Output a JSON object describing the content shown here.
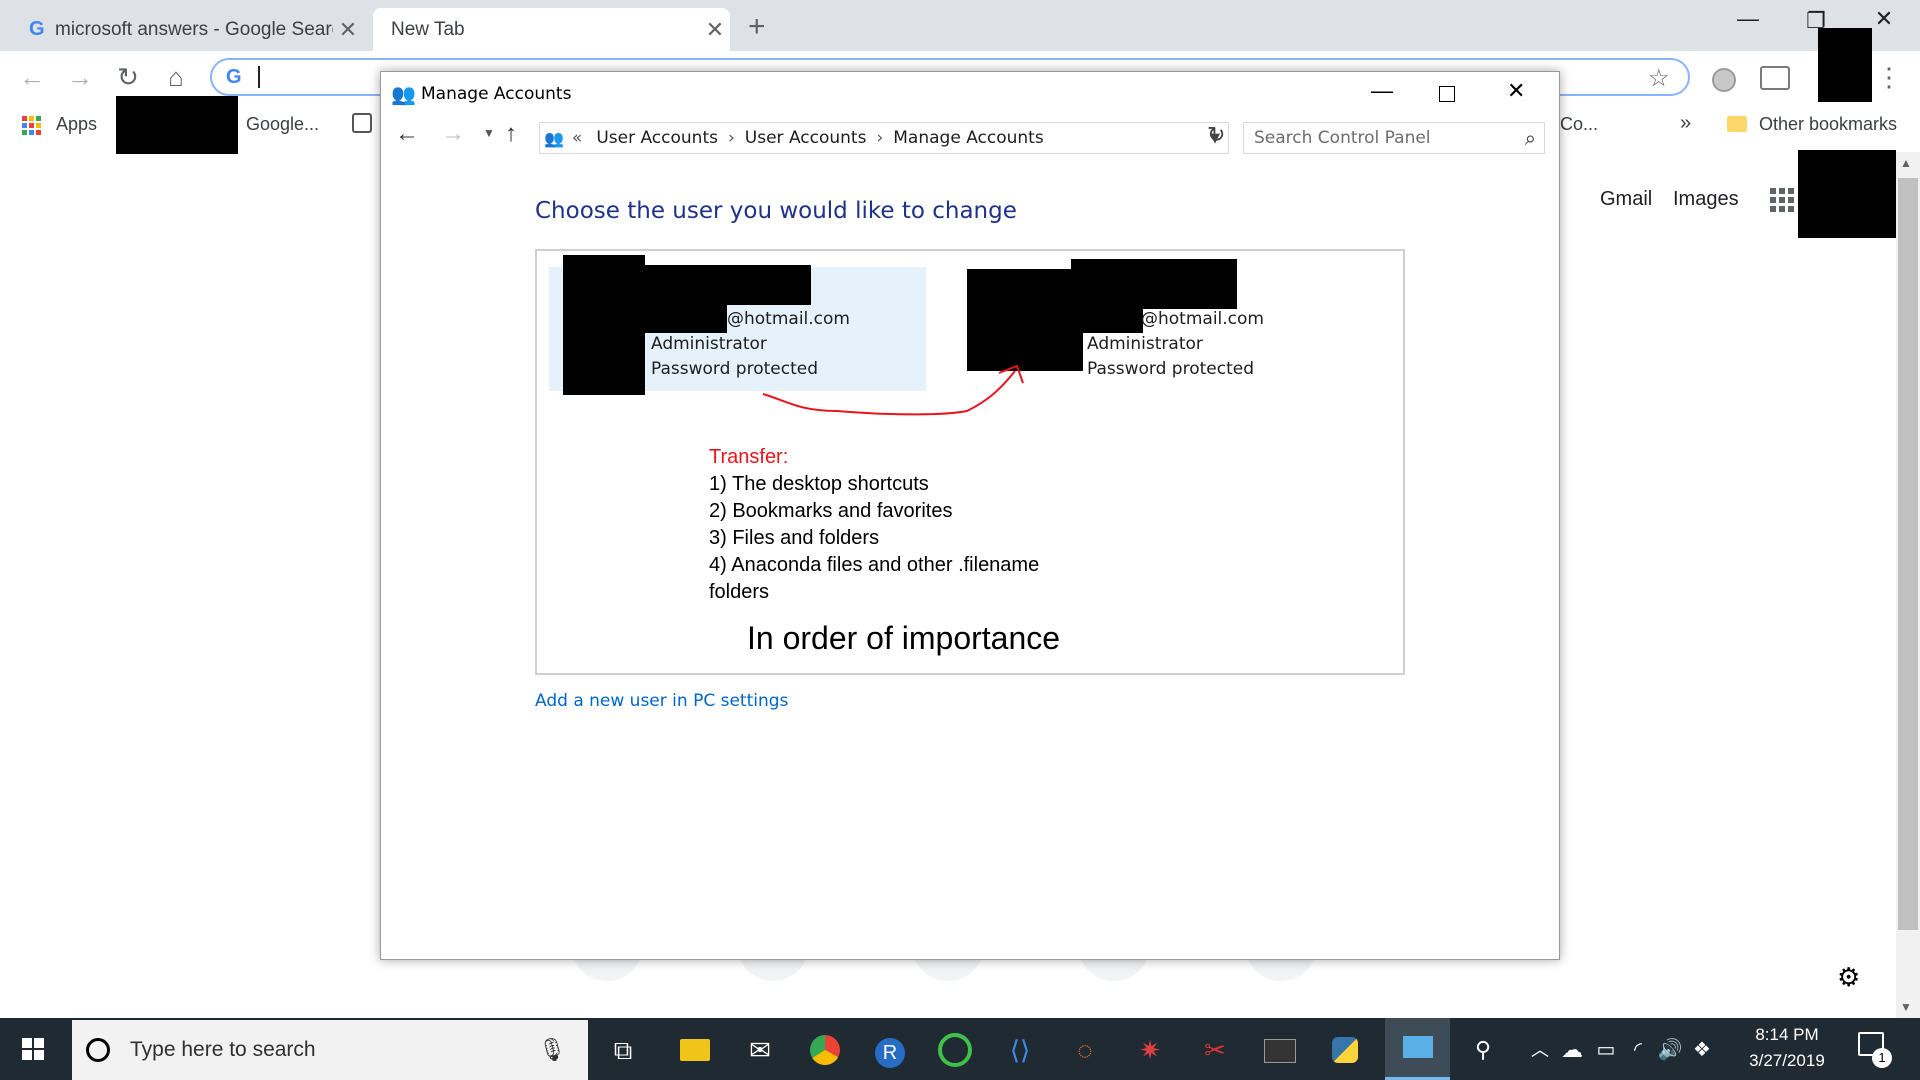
{
  "browser": {
    "tabs": [
      {
        "label": "microsoft answers - Google Search",
        "favicon": "google-g-icon"
      },
      {
        "label": "New Tab"
      }
    ],
    "bookmarks": {
      "apps_label": "Apps",
      "items": [
        "Google...",
        "Co..."
      ],
      "overflow": "»",
      "other_label": "Other bookmarks"
    },
    "google_links": {
      "gmail": "Gmail",
      "images": "Images"
    }
  },
  "window": {
    "title": "Manage Accounts",
    "breadcrumb": [
      "User Accounts",
      "User Accounts",
      "Manage Accounts"
    ],
    "breadcrumb_prefix": "«",
    "search_placeholder": "Search Control Panel",
    "heading": "Choose the user you would like to change",
    "accounts": [
      {
        "email_suffix": "@hotmail.com",
        "role": "Administrator",
        "status": "Password protected",
        "selected": true
      },
      {
        "email_suffix": "@hotmail.com",
        "role": "Administrator",
        "status": "Password protected",
        "selected": false
      }
    ],
    "annotation": {
      "title": "Transfer:",
      "items": [
        "1) The desktop shortcuts",
        "2) Bookmarks and favorites",
        "3) Files and folders",
        "4) Anaconda files and other .filename",
        "folders"
      ],
      "footer": "In order of importance"
    },
    "add_user_link": "Add a new user in PC settings"
  },
  "taskbar": {
    "search_placeholder": "Type here to search",
    "time": "8:14 PM",
    "date": "3/27/2019",
    "notification_count": "1"
  },
  "colors": {
    "heading": "#1e3287",
    "link": "#0066cc",
    "annotation_red": "#e8141b",
    "selected_account": "#e5f1fb",
    "taskbar": "#1f2a33"
  }
}
